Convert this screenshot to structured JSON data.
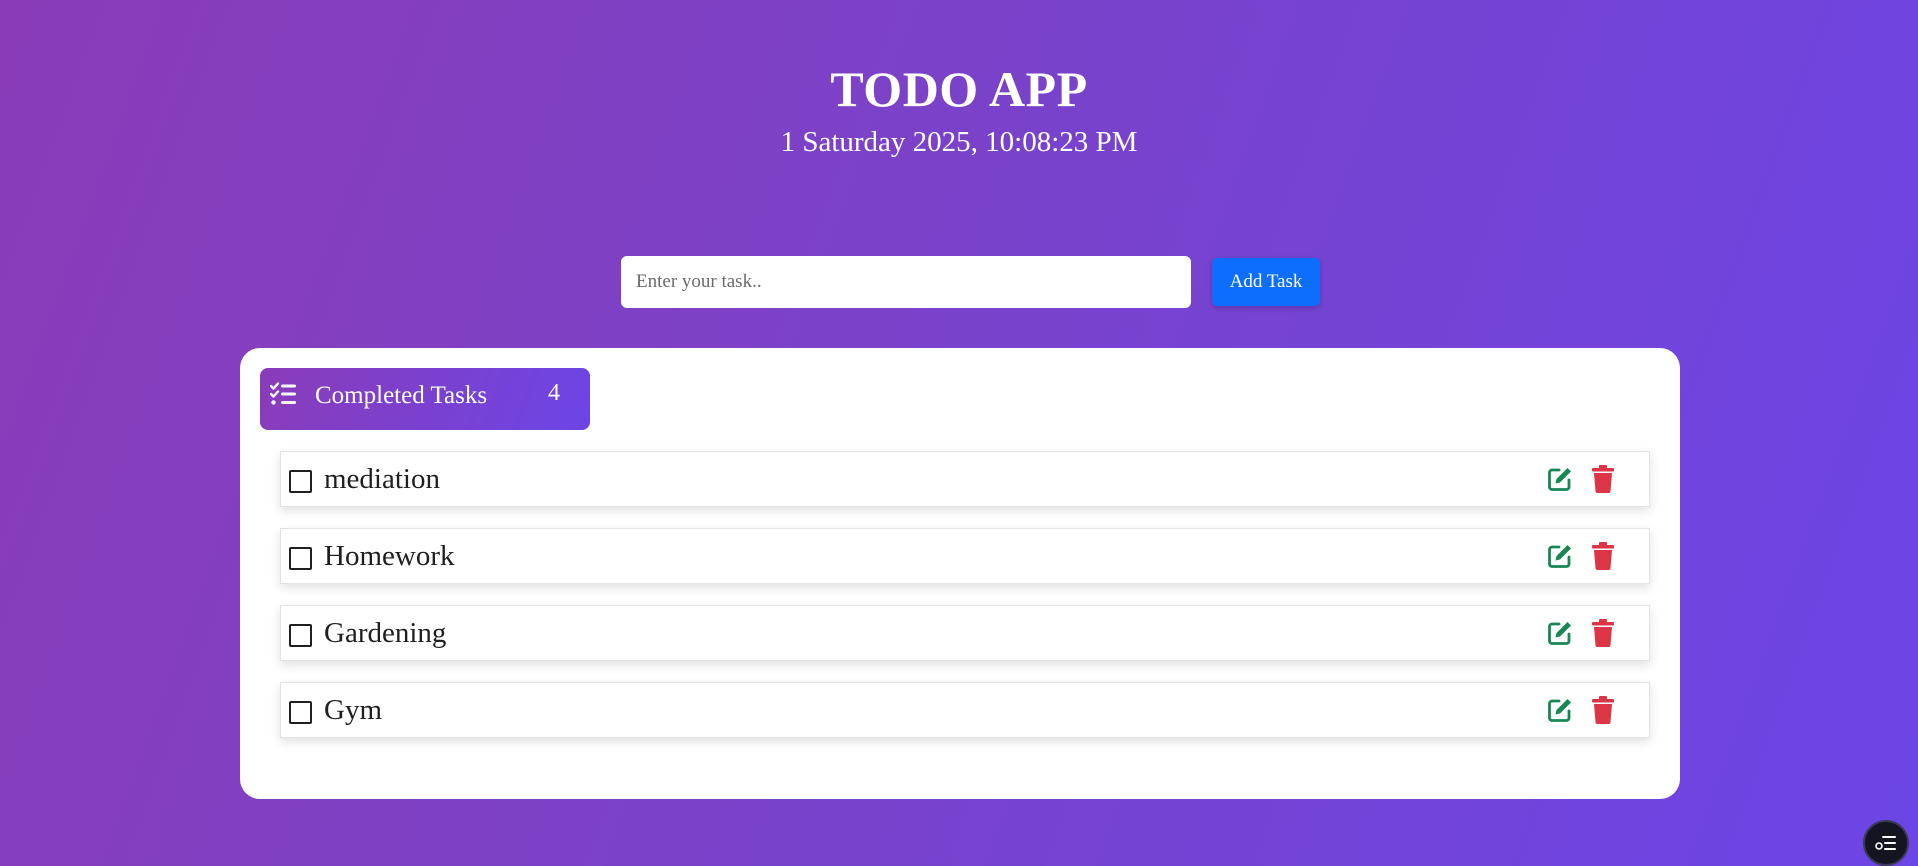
{
  "header": {
    "title": "TODO APP",
    "datetime": "1 Saturday 2025, 10:08:23 PM"
  },
  "add_task": {
    "placeholder": "Enter your task..",
    "value": "",
    "button_label": "Add Task"
  },
  "completed_tab": {
    "icon": "list-check-icon",
    "label": "Completed Tasks",
    "count": "4"
  },
  "tasks": [
    {
      "text": "mediation",
      "checked": false
    },
    {
      "text": "Homework",
      "checked": false
    },
    {
      "text": "Gardening",
      "checked": false
    },
    {
      "text": "Gym",
      "checked": false
    }
  ],
  "icons": {
    "edit": "edit-icon",
    "delete": "trash-icon",
    "floating": "settings-list-icon"
  },
  "colors": {
    "background_start": "#8a3cb8",
    "background_end": "#6c45e6",
    "add_button": "#0d6efd",
    "edit_icon": "#198754",
    "delete_icon": "#dc3545"
  }
}
